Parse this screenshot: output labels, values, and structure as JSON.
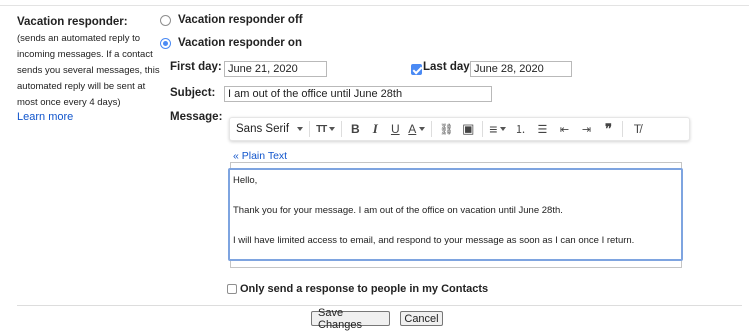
{
  "responder": {
    "section_label": "Vacation responder:",
    "description": "(sends an automated reply to incoming messages. If a contact sends you several messages, this automated reply will be sent at most once every 4 days)",
    "learn_more": "Learn more",
    "off_label": "Vacation responder off",
    "on_label": "Vacation responder on",
    "selected": "on"
  },
  "first_day": {
    "label": "First day:",
    "value": "June 21, 2020"
  },
  "last_day": {
    "label": "Last day:",
    "value": "June 28, 2020",
    "checked": true
  },
  "subject": {
    "label": "Subject:",
    "value": "I am out of the office until June 28th"
  },
  "message": {
    "label": "Message:",
    "font": "Sans Serif",
    "plain_text_link": "« Plain Text",
    "lines": [
      "Hello,",
      "Thank you for your message. I am out of the office on vacation until June 28th.",
      "I will have limited access to email, and respond to your message as soon as I can once I return."
    ]
  },
  "toolbar": {
    "icons": [
      "font-size-icon",
      "bold-icon",
      "italic-icon",
      "underline-icon",
      "text-color-icon",
      "link-icon",
      "image-icon",
      "align-icon",
      "numbered-list-icon",
      "bulleted-list-icon",
      "indent-less-icon",
      "indent-more-icon",
      "quote-icon",
      "remove-formatting-icon"
    ],
    "glyphs": {
      "font_size": "TT",
      "bold": "B",
      "italic": "I",
      "underline": "U",
      "text_color": "A",
      "link": "⛓",
      "image": "▣",
      "align": "≡",
      "numbered": "⒈",
      "bulleted": "☰",
      "indent_less": "⇤",
      "indent_more": "⇥",
      "quote": "❞",
      "clear": "T̸"
    }
  },
  "contacts_only": {
    "label": "Only send a response to people in my Contacts",
    "checked": false
  },
  "buttons": {
    "save": "Save Changes",
    "cancel": "Cancel"
  },
  "colors": {
    "accent": "#4a8af4",
    "link": "#1155cc",
    "editor_focus": "#7ea4e0"
  }
}
